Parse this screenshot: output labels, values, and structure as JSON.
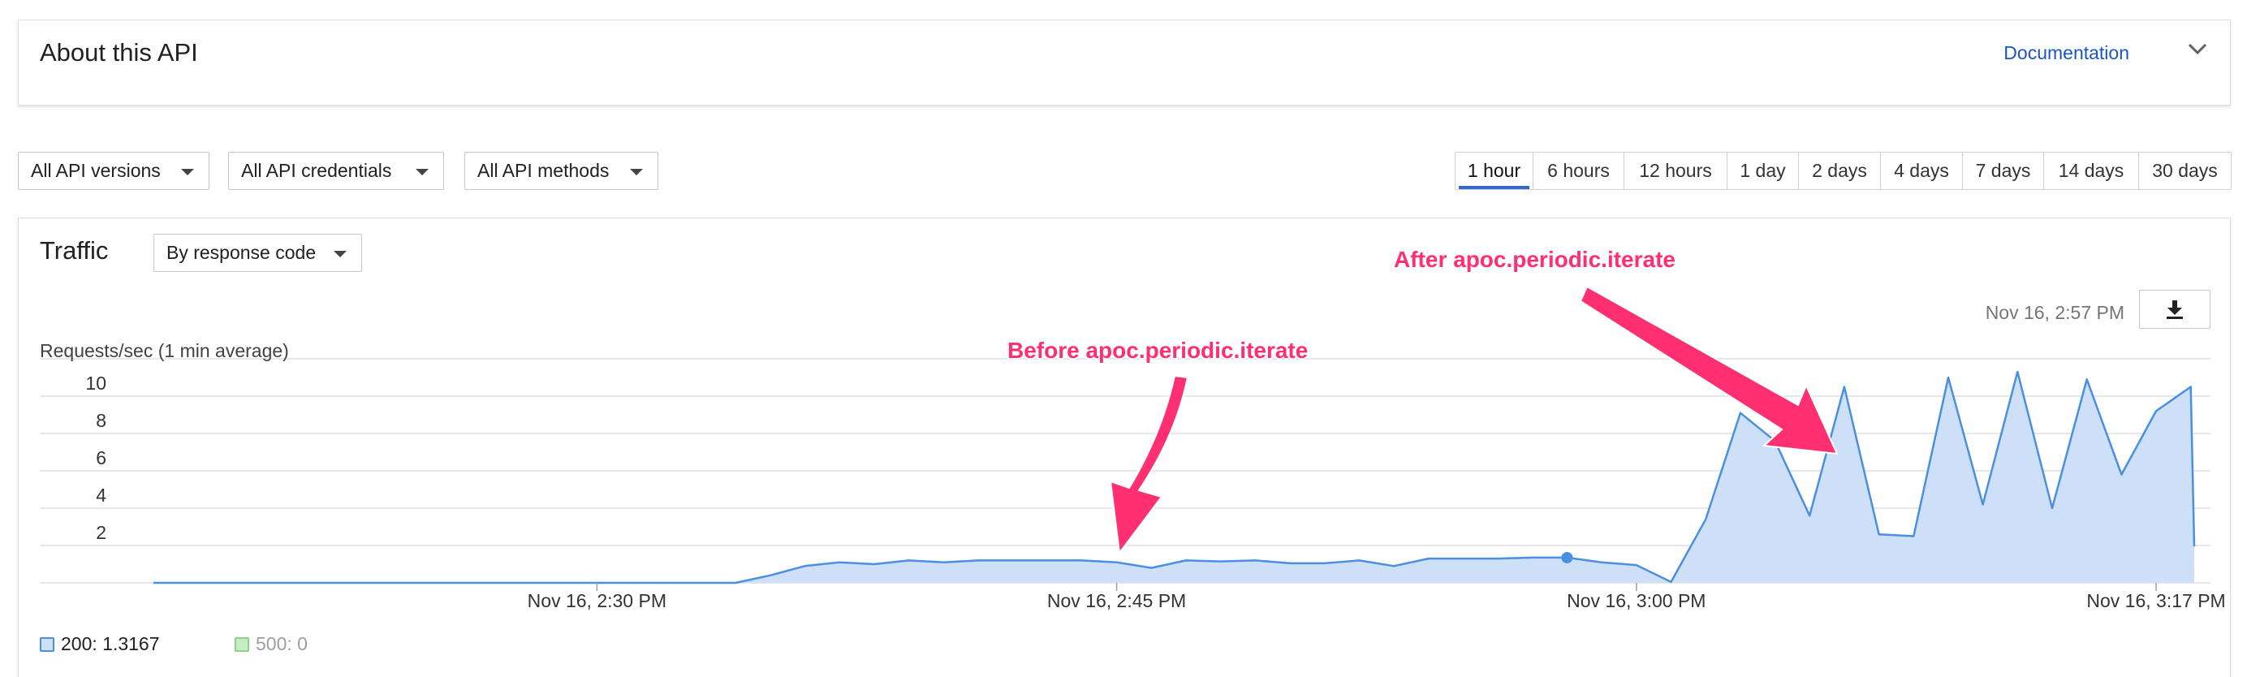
{
  "about": {
    "title": "About this API",
    "doc_link": "Documentation",
    "chevron_icon": "chevron-down-icon"
  },
  "filters": {
    "versions": "All API versions",
    "credentials": "All API credentials",
    "methods": "All API methods"
  },
  "time_range": {
    "options": [
      "1 hour",
      "6 hours",
      "12 hours",
      "1 day",
      "2 days",
      "4 days",
      "7 days",
      "14 days",
      "30 days"
    ],
    "selected": "1 hour"
  },
  "traffic": {
    "title": "Traffic",
    "group_by": "By response code",
    "timestamp": "Nov 16, 2:57 PM",
    "download_icon": "download-icon",
    "annotations": {
      "before": "Before apoc.periodic.iterate",
      "after": "After apoc.periodic.iterate"
    }
  },
  "chart_data": {
    "type": "area",
    "ylabel": "Requests/sec (1 min average)",
    "yticks": [
      2,
      4,
      6,
      8,
      10
    ],
    "ylim": [
      0,
      11
    ],
    "xticks": [
      {
        "t": 0,
        "label": "Nov 16, 2:30 PM"
      },
      {
        "t": 15,
        "label": "Nov 16, 2:45 PM"
      },
      {
        "t": 30,
        "label": "Nov 16, 3:00 PM"
      },
      {
        "t": 45,
        "label": "Nov 16, 3:17 PM"
      }
    ],
    "x_range": [
      -12.8,
      46.1
    ],
    "series": [
      {
        "name": "200",
        "value_label": "200: 1.3167",
        "color": "#4a8fe0",
        "fill": "#cde0f8",
        "points": [
          [
            -12.8,
            0
          ],
          [
            -5.0,
            0
          ],
          [
            2.0,
            0
          ],
          [
            4.0,
            0
          ],
          [
            5.0,
            0.4
          ],
          [
            6.0,
            0.9
          ],
          [
            7.0,
            1.1
          ],
          [
            8.0,
            1.0
          ],
          [
            9.0,
            1.2
          ],
          [
            10.0,
            1.1
          ],
          [
            11.0,
            1.2
          ],
          [
            12.0,
            1.2
          ],
          [
            13.0,
            1.2
          ],
          [
            14.0,
            1.2
          ],
          [
            15.0,
            1.1
          ],
          [
            16.0,
            0.8
          ],
          [
            17.0,
            1.2
          ],
          [
            18.0,
            1.15
          ],
          [
            19.0,
            1.2
          ],
          [
            20.0,
            1.05
          ],
          [
            21.0,
            1.05
          ],
          [
            22.0,
            1.2
          ],
          [
            23.0,
            0.9
          ],
          [
            24.0,
            1.3
          ],
          [
            25.0,
            1.3
          ],
          [
            26.0,
            1.3
          ],
          [
            27.0,
            1.35
          ],
          [
            28.0,
            1.35
          ],
          [
            29.0,
            1.1
          ],
          [
            30.0,
            0.95
          ],
          [
            31.0,
            0.05
          ],
          [
            32.0,
            3.4
          ],
          [
            33.0,
            9.1
          ],
          [
            34.0,
            7.6
          ],
          [
            35.0,
            3.6
          ],
          [
            36.0,
            10.5
          ],
          [
            37.0,
            2.6
          ],
          [
            38.0,
            2.5
          ],
          [
            39.0,
            11.0
          ],
          [
            40.0,
            4.2
          ],
          [
            41.0,
            11.3
          ],
          [
            42.0,
            4.0
          ],
          [
            43.0,
            10.9
          ],
          [
            44.0,
            5.8
          ],
          [
            45.0,
            9.2
          ],
          [
            46.0,
            10.5
          ],
          [
            46.1,
            1.95
          ]
        ],
        "highlight": [
          28.0,
          1.35
        ]
      },
      {
        "name": "500",
        "value_label": "500: 0",
        "color": "#8fd18a",
        "fill": "#c8ecc5",
        "points": []
      }
    ]
  }
}
